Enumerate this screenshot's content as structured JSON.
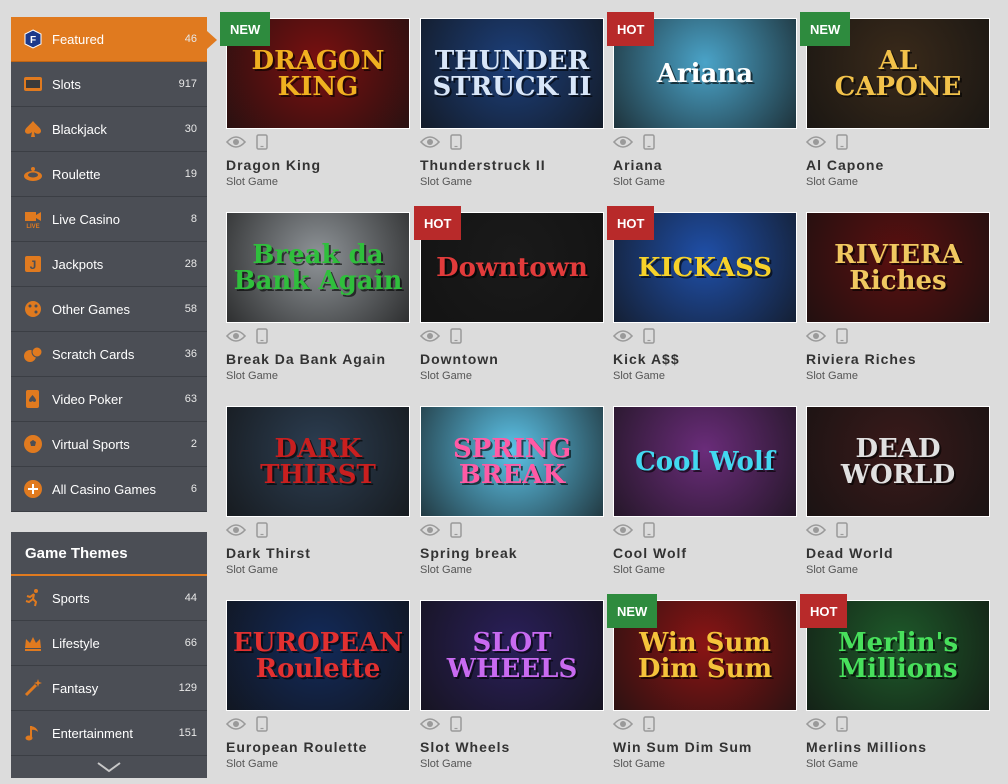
{
  "nav": [
    {
      "label": "Featured",
      "count": "46",
      "icon": "featured-icon",
      "active": true
    },
    {
      "label": "Slots",
      "count": "917",
      "icon": "slots-icon"
    },
    {
      "label": "Blackjack",
      "count": "30",
      "icon": "spade-icon"
    },
    {
      "label": "Roulette",
      "count": "19",
      "icon": "roulette-icon"
    },
    {
      "label": "Live Casino",
      "count": "8",
      "icon": "live-camera-icon"
    },
    {
      "label": "Jackpots",
      "count": "28",
      "icon": "jackpot-icon"
    },
    {
      "label": "Other Games",
      "count": "58",
      "icon": "dice-icon"
    },
    {
      "label": "Scratch Cards",
      "count": "36",
      "icon": "scratch-card-icon"
    },
    {
      "label": "Video Poker",
      "count": "63",
      "icon": "poker-card-icon"
    },
    {
      "label": "Virtual Sports",
      "count": "2",
      "icon": "soccer-ball-icon"
    },
    {
      "label": "All Casino Games",
      "count": "6",
      "icon": "plus-circle-icon"
    }
  ],
  "themes": {
    "title": "Game Themes",
    "items": [
      {
        "label": "Sports",
        "count": "44",
        "icon": "runner-icon"
      },
      {
        "label": "Lifestyle",
        "count": "66",
        "icon": "crown-icon"
      },
      {
        "label": "Fantasy",
        "count": "129",
        "icon": "magic-wand-icon"
      },
      {
        "label": "Entertainment",
        "count": "151",
        "icon": "music-note-icon"
      }
    ]
  },
  "games": [
    {
      "title": "Dragon King",
      "sub": "Slot Game",
      "badge": "NEW",
      "art": "DRAGON KING",
      "bg": "#7a1010",
      "fg": "#f0b020"
    },
    {
      "title": "Thunderstruck II",
      "sub": "Slot Game",
      "badge": "",
      "art": "THUNDER STRUCK II",
      "bg": "#1c3f7a",
      "fg": "#d8e6f8"
    },
    {
      "title": "Ariana",
      "sub": "Slot Game",
      "badge": "HOT",
      "art": "Ariana",
      "bg": "#4aa3c8",
      "fg": "#ffffff"
    },
    {
      "title": "Al Capone",
      "sub": "Slot Game",
      "badge": "NEW",
      "art": "AL CAPONE",
      "bg": "#3a2a1a",
      "fg": "#f2c24a"
    },
    {
      "title": "Break Da Bank Again",
      "sub": "Slot Game",
      "badge": "",
      "art": "Break da Bank Again",
      "bg": "#8f9498",
      "fg": "#2fbf3c"
    },
    {
      "title": "Downtown",
      "sub": "Slot Game",
      "badge": "HOT",
      "art": "Downtown",
      "bg": "#1a1a1a",
      "fg": "#e23b3b"
    },
    {
      "title": "Kick A$$",
      "sub": "Slot Game",
      "badge": "HOT",
      "art": "KICKASS",
      "bg": "#1f4fa8",
      "fg": "#f7d22a"
    },
    {
      "title": "Riviera Riches",
      "sub": "Slot Game",
      "badge": "",
      "art": "RIVIERA Riches",
      "bg": "#5a0f0f",
      "fg": "#f0c860"
    },
    {
      "title": "Dark Thirst",
      "sub": "Slot Game",
      "badge": "",
      "art": "DARK THIRST",
      "bg": "#2c3e52",
      "fg": "#c91f1f"
    },
    {
      "title": "Spring break",
      "sub": "Slot Game",
      "badge": "",
      "art": "SPRING BREAK",
      "bg": "#5cc3e8",
      "fg": "#ff5aa5"
    },
    {
      "title": "Cool Wolf",
      "sub": "Slot Game",
      "badge": "",
      "art": "Cool Wolf",
      "bg": "#6a2c7a",
      "fg": "#42d8f0"
    },
    {
      "title": "Dead World",
      "sub": "Slot Game",
      "badge": "",
      "art": "DEAD WORLD",
      "bg": "#3a1a1a",
      "fg": "#e0e0e0"
    },
    {
      "title": "European Roulette",
      "sub": "Slot Game",
      "badge": "",
      "art": "EUROPEAN Roulette",
      "bg": "#122a5a",
      "fg": "#e23030"
    },
    {
      "title": "Slot Wheels",
      "sub": "Slot Game",
      "badge": "",
      "art": "SLOT WHEELS",
      "bg": "#2a1f5a",
      "fg": "#c86af0"
    },
    {
      "title": "Win Sum Dim Sum",
      "sub": "Slot Game",
      "badge": "NEW",
      "art": "Win Sum Dim Sum",
      "bg": "#8a1414",
      "fg": "#f5c33b"
    },
    {
      "title": "Merlins Millions",
      "sub": "Slot Game",
      "badge": "HOT",
      "art": "Merlin's Millions",
      "bg": "#1e5a2a",
      "fg": "#48e05c"
    }
  ],
  "colors": {
    "accent": "#e07a1f",
    "sidebar": "#4b4e55",
    "badge_new": "#2e8b3e",
    "badge_hot": "#b82a2a"
  }
}
